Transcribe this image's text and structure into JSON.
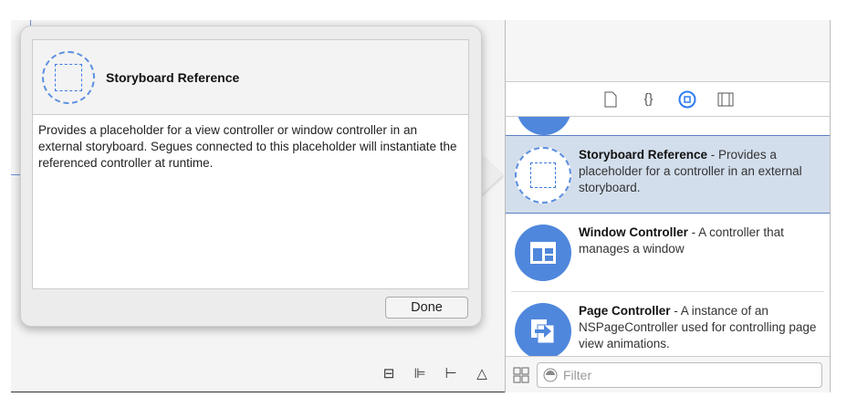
{
  "popover": {
    "title": "Storyboard Reference",
    "description": "Provides a placeholder for a view controller or window controller in an external storyboard. Segues connected to this placeholder will instantiate the referenced controller at runtime.",
    "done_label": "Done"
  },
  "library": {
    "tabs": [
      {
        "icon": "file-icon"
      },
      {
        "icon": "braces-icon"
      },
      {
        "icon": "object-icon",
        "active": true
      },
      {
        "icon": "media-icon"
      }
    ],
    "items": [
      {
        "name": "Storyboard Reference",
        "desc": " - Provides a placeholder for a controller in an external storyboard.",
        "selected": true
      },
      {
        "name": "Window Controller",
        "desc": " - A controller that manages a window"
      },
      {
        "name": "Page Controller",
        "desc": " - A instance of an NSPageController used for controlling page view animations."
      }
    ],
    "filter_placeholder": "Filter"
  },
  "colors": {
    "accent": "#4f87dc",
    "selection": "#d3deec"
  }
}
